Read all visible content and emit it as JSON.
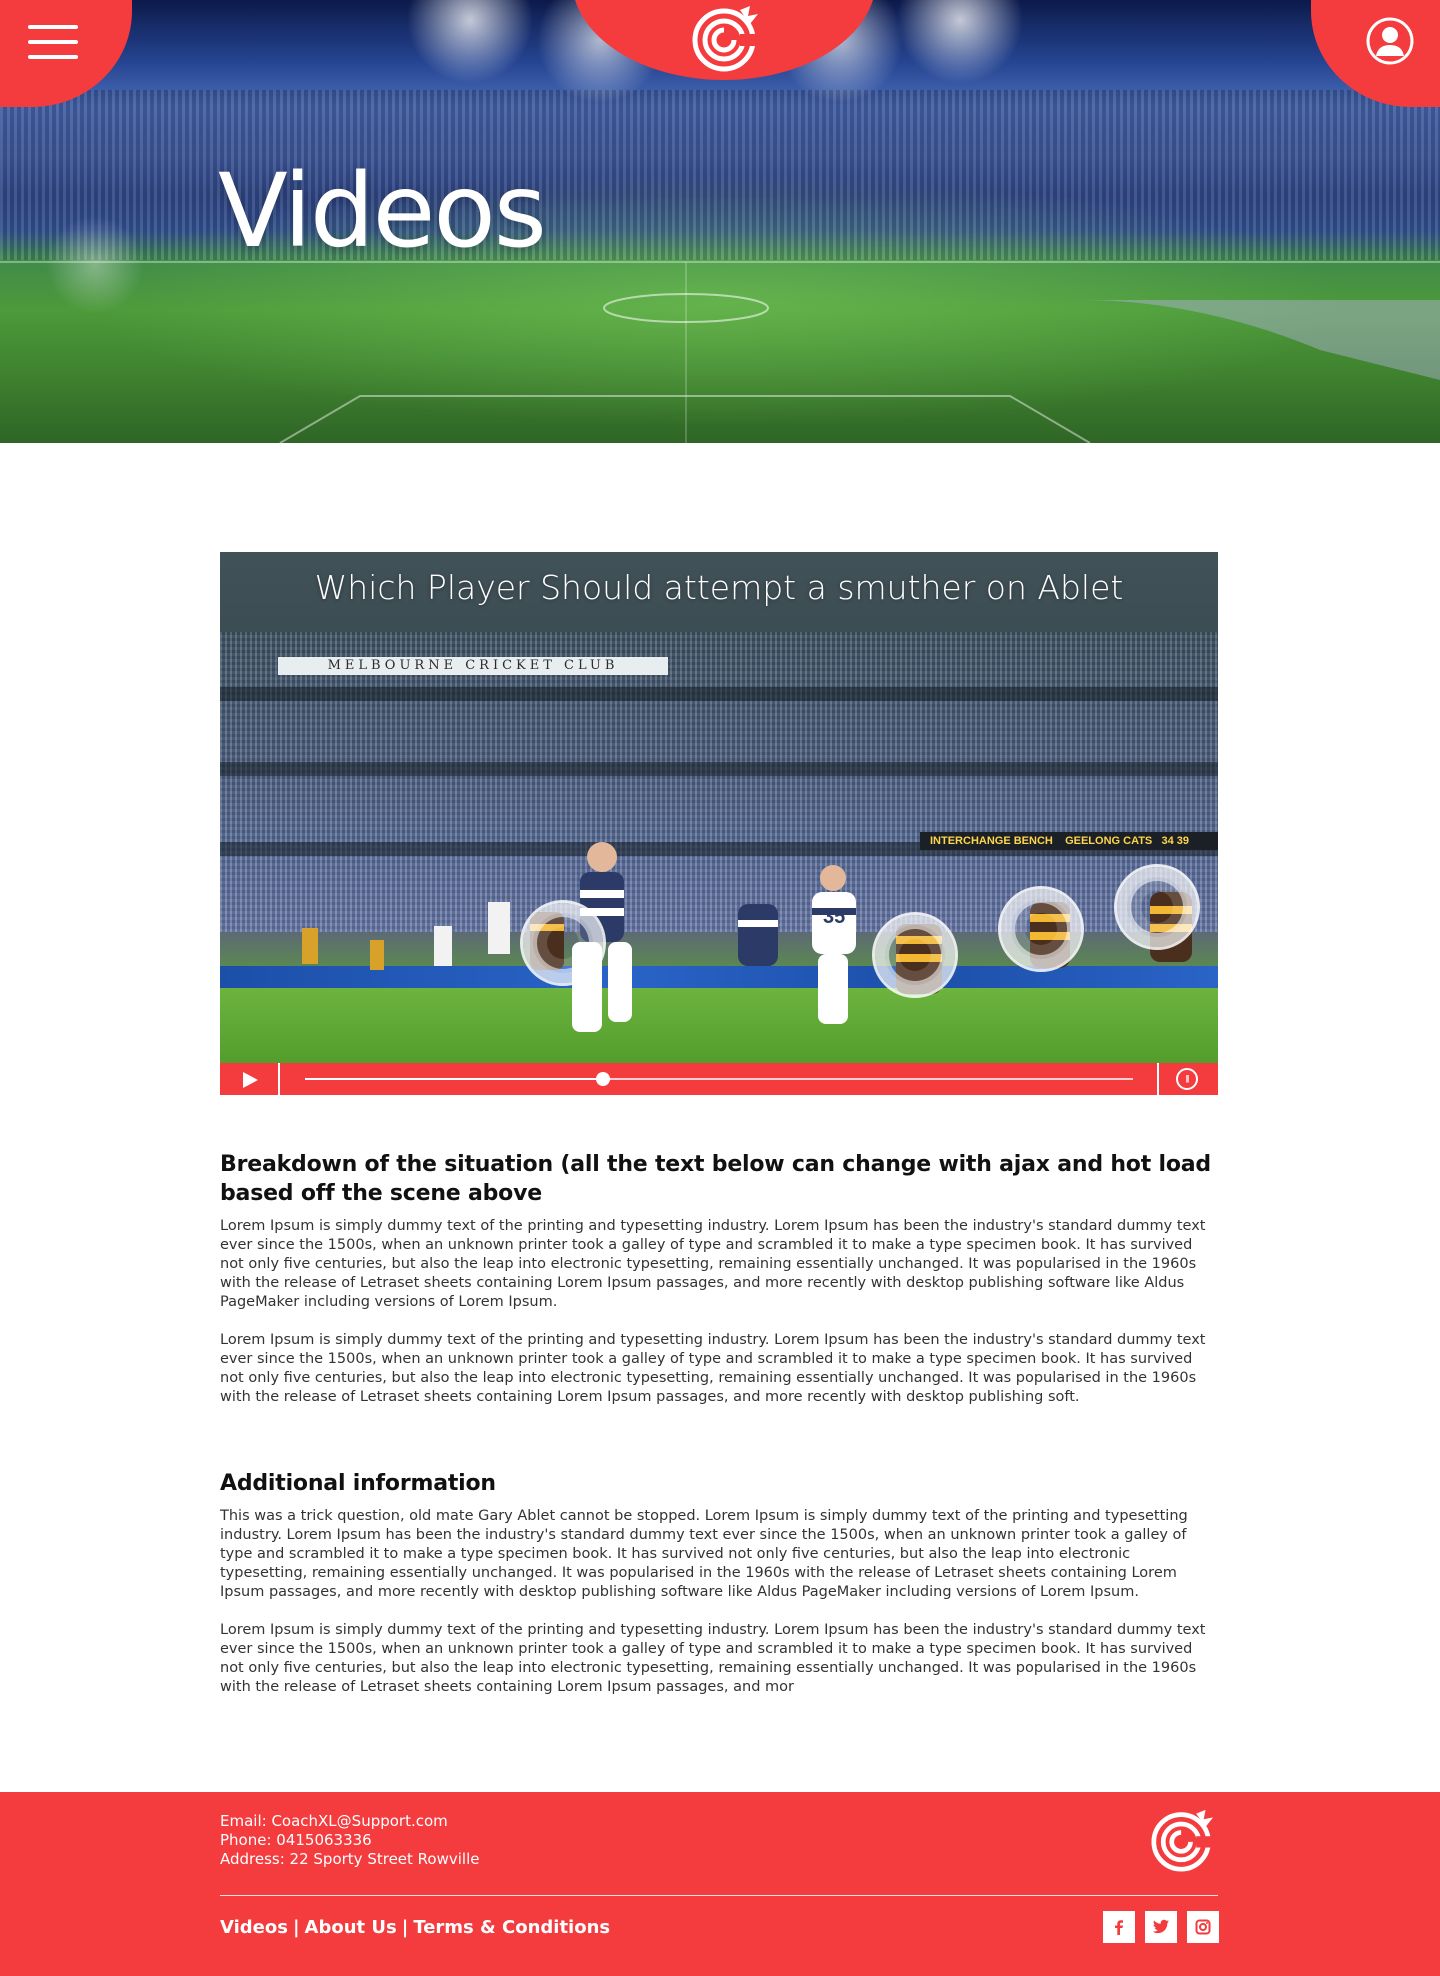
{
  "header": {
    "title": "Videos",
    "icons": {
      "menu": "hamburger-menu-icon",
      "logo": "coachxl-logo",
      "user": "user-profile-icon"
    }
  },
  "video": {
    "title": "Which Player Should attempt a smuther on Ablet",
    "stadium_sign": "MELBOURNE CRICKET CLUB",
    "bench_sign": "INTERCHANGE BENCH",
    "scoreboard": "GEELONG CATS",
    "scoreboard_score": "34 39",
    "player_number": "35",
    "progress": 0.36
  },
  "article": {
    "section1": {
      "heading": "Breakdown of the situation (all the text below can change with ajax and hot load based off the scene above",
      "paragraphs": [
        "Lorem Ipsum is simply dummy text of the printing and typesetting industry. Lorem Ipsum has been the industry's standard dummy text ever since the 1500s, when an unknown printer took a galley of type and scrambled it to make a type specimen book. It has survived not only five centuries, but also the leap into electronic typesetting, remaining essentially unchanged. It was popularised in the 1960s with the release of Letraset sheets containing Lorem Ipsum passages, and more recently with desktop publishing software like Aldus PageMaker including versions of Lorem Ipsum.",
        "Lorem Ipsum is simply dummy text of the printing and typesetting industry. Lorem Ipsum has been the industry's standard dummy text ever since the 1500s, when an unknown printer took a galley of type and scrambled it to make a type specimen book. It has survived not only five centuries, but also the leap into electronic typesetting, remaining essentially unchanged. It was popularised in the 1960s with the release of Letraset sheets containing Lorem Ipsum passages, and more recently with desktop publishing soft."
      ]
    },
    "section2": {
      "heading": "Additional information",
      "paragraphs": [
        "This was a trick question, old mate Gary Ablet cannot be stopped. Lorem Ipsum is simply dummy text of the printing and typesetting industry. Lorem Ipsum has been the industry's standard dummy text ever since the 1500s, when an unknown printer took a galley of type and scrambled it to make a type specimen book. It has survived not only five centuries, but also the leap into electronic typesetting, remaining essentially unchanged. It was popularised in the 1960s with the release of Letraset sheets containing Lorem Ipsum passages, and more recently with desktop publishing software like Aldus PageMaker including versions of Lorem Ipsum.",
        "Lorem Ipsum is simply dummy text of the printing and typesetting industry. Lorem Ipsum has been the industry's standard dummy text ever since the 1500s, when an unknown printer took a galley of type and scrambled it to make a type specimen book. It has survived not only five centuries, but also the leap into electronic typesetting, remaining essentially unchanged. It was popularised in the 1960s with the release of Letraset sheets containing Lorem Ipsum passages, and mor"
      ]
    }
  },
  "footer": {
    "email": "Email: CoachXL@Support.com",
    "phone": "Phone: 0415063336",
    "address": "Address: 22 Sporty Street Rowville",
    "links": [
      "Videos",
      "About Us",
      "Terms & Conditions"
    ],
    "separator": "|",
    "social": [
      "facebook-icon",
      "twitter-icon",
      "instagram-icon"
    ]
  },
  "colors": {
    "brand_red": "#f43b3e",
    "text_dark": "#111111",
    "text_body": "#333333"
  }
}
